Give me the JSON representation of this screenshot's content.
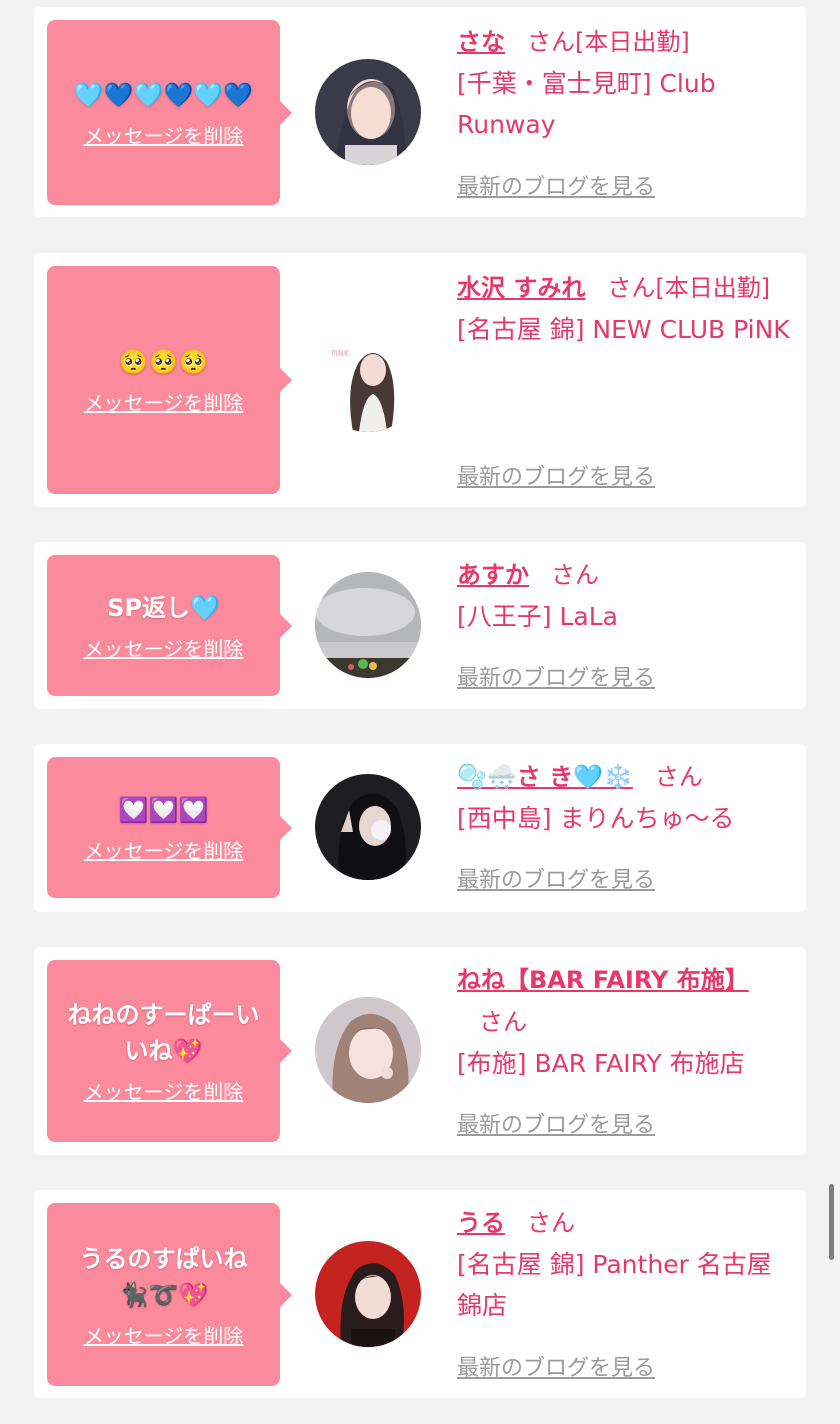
{
  "cards": [
    {
      "message": "🩵💙🩵💙🩵💙",
      "delete_label": "メッセージを削除",
      "name": "さな",
      "honorific": "さん",
      "status": "[本日出勤]",
      "shop": "[千葉・富士見町] Club Runway",
      "blog_label": "最新のブログを見る"
    },
    {
      "message": "🥺🥺🥺",
      "delete_label": "メッセージを削除",
      "name": "水沢 すみれ",
      "honorific": "さん",
      "status": "[本日出勤]",
      "shop": "[名古屋 錦] NEW CLUB PiNK",
      "blog_label": "最新のブログを見る"
    },
    {
      "message": "SP返し🩵",
      "delete_label": "メッセージを削除",
      "name": "あすか",
      "honorific": "さん",
      "status": "",
      "shop": "[八王子] LaLa",
      "blog_label": "最新のブログを見る"
    },
    {
      "message": "💟💟💟",
      "delete_label": "メッセージを削除",
      "name": "🫧🌨️さ き🩵❄️",
      "honorific": "さん",
      "status": "",
      "shop": "[西中島] まりんちゅ〜る",
      "blog_label": "最新のブログを見る"
    },
    {
      "message": "ねねのすーぱーいいね💖",
      "delete_label": "メッセージを削除",
      "name": "ねね【BAR FAIRY 布施】",
      "honorific": "さん",
      "status": "",
      "shop": "[布施] BAR FAIRY 布施店",
      "blog_label": "最新のブログを見る"
    },
    {
      "message": "うるのすぱいね🐈‍⬛➰💖",
      "delete_label": "メッセージを削除",
      "name": "うる",
      "honorific": "さん",
      "status": "",
      "shop": "[名古屋 錦] Panther 名古屋錦店",
      "blog_label": "最新のブログを見る"
    }
  ]
}
